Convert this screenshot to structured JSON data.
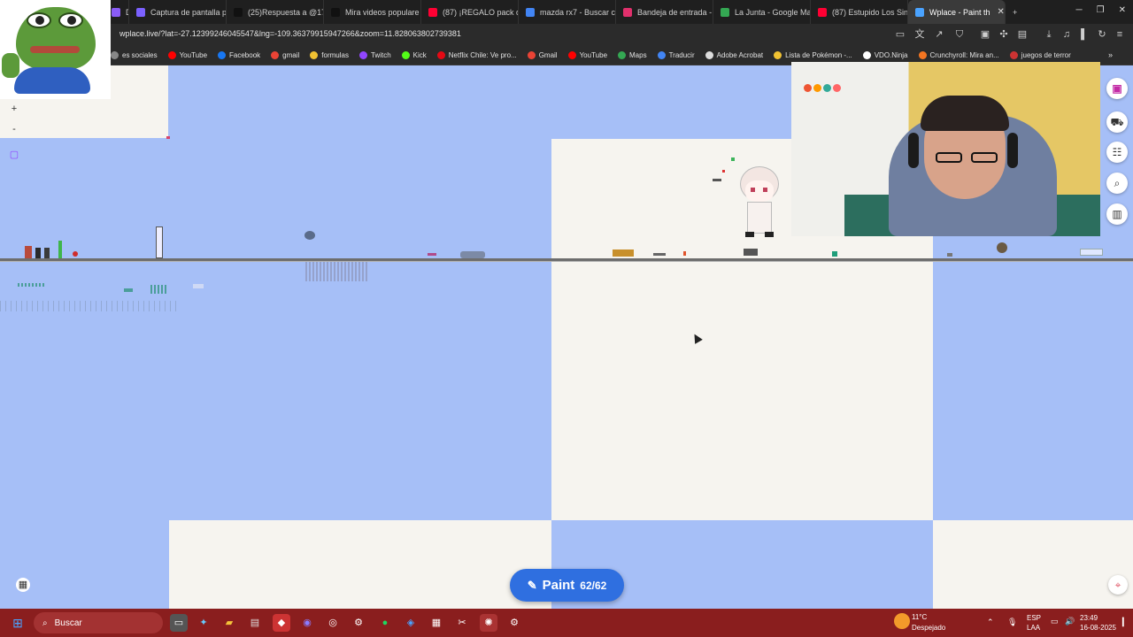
{
  "browser": {
    "tabs": [
      {
        "label": "Dashb",
        "color": "#8a5cf6"
      },
      {
        "label": "Captura de pantalla p",
        "color": "#7b61ff"
      },
      {
        "label": "(25)Respuesta a @17",
        "color": "#111111"
      },
      {
        "label": "Mira videos populare",
        "color": "#111111"
      },
      {
        "label": "(87) ¡REGALO pack de",
        "color": "#ff0033"
      },
      {
        "label": "mazda rx7 - Buscar c",
        "color": "#4285f4"
      },
      {
        "label": "Bandeja de entrada -",
        "color": "#e1306c"
      },
      {
        "label": "La Junta - Google Ma",
        "color": "#34a853"
      },
      {
        "label": "(87) Estupido Los Sin",
        "color": "#ff0033"
      },
      {
        "label": "Wplace - Paint th",
        "color": "#4aa3ff",
        "active": true
      }
    ],
    "url": "wplace.live/?lat=-27.12399246045547&lng=-109.36379915947266&zoom=11.828063802739381",
    "bookmarks": [
      {
        "label": "es sociales",
        "color": "#888888"
      },
      {
        "label": "YouTube",
        "color": "#ff0000"
      },
      {
        "label": "Facebook",
        "color": "#1877f2"
      },
      {
        "label": "gmail",
        "color": "#ea4335"
      },
      {
        "label": "formulas",
        "color": "#f1c232"
      },
      {
        "label": "Twitch",
        "color": "#9146ff"
      },
      {
        "label": "Kick",
        "color": "#53fc18"
      },
      {
        "label": "Netflix Chile: Ve pro...",
        "color": "#e50914"
      },
      {
        "label": "Gmail",
        "color": "#ea4335"
      },
      {
        "label": "YouTube",
        "color": "#ff0000"
      },
      {
        "label": "Maps",
        "color": "#34a853"
      },
      {
        "label": "Traducir",
        "color": "#4285f4"
      },
      {
        "label": "Adobe Acrobat",
        "color": "#dddddd"
      },
      {
        "label": "Lista de Pokémon -...",
        "color": "#f1c232"
      },
      {
        "label": "VDO.Ninja",
        "color": "#ffffff"
      },
      {
        "label": "Crunchyroll: Mira an...",
        "color": "#f47521"
      },
      {
        "label": "juegos de terror",
        "color": "#cc3333"
      }
    ]
  },
  "app": {
    "paint_label": "Paint",
    "paint_count": "62/62"
  },
  "taskbar": {
    "search_placeholder": "Buscar",
    "weather_temp": "11°C",
    "weather_desc": "Despejado",
    "lang1": "ESP",
    "lang2": "LAA",
    "time": "23:49",
    "date": "16-08-2025"
  }
}
